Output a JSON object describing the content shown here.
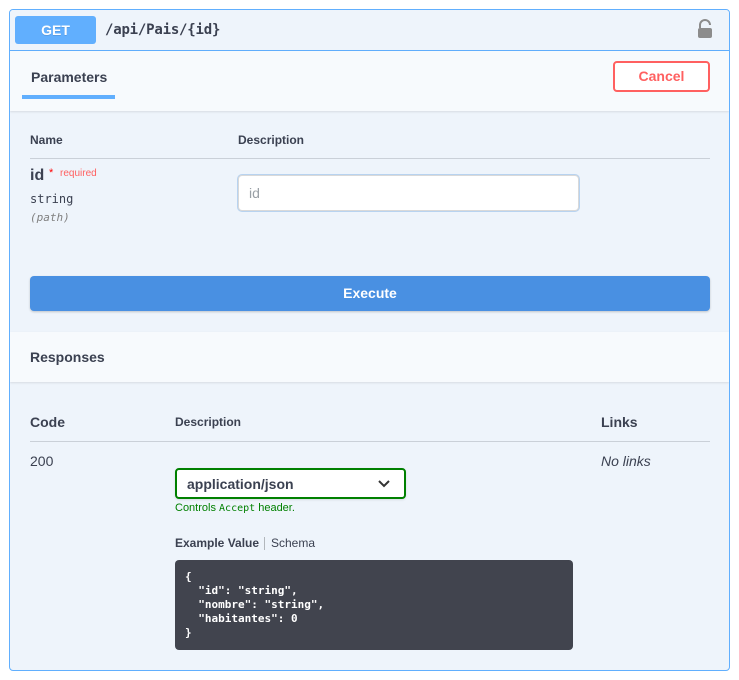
{
  "operation": {
    "method": "GET",
    "path": "/api/Pais/{id}",
    "lock_icon": "unlock-icon"
  },
  "parameters": {
    "tab_label": "Parameters",
    "cancel_label": "Cancel",
    "col_name": "Name",
    "col_description": "Description",
    "items": [
      {
        "name": "id",
        "required_star": "*",
        "required_label": "required",
        "type": "string",
        "in": "(path)",
        "placeholder": "id",
        "value": ""
      }
    ],
    "execute_label": "Execute"
  },
  "responses": {
    "title": "Responses",
    "col_code": "Code",
    "col_description": "Description",
    "col_links": "Links",
    "rows": [
      {
        "code": "200",
        "links": "No links",
        "media_type": "application/json",
        "controls_prefix": "Controls ",
        "controls_header": "Accept",
        "controls_suffix": " header.",
        "tab_example": "Example Value",
        "tab_schema": "Schema",
        "example": "{\n  \"id\": \"string\",\n  \"nombre\": \"string\",\n  \"habitantes\": 0\n}"
      }
    ]
  },
  "colors": {
    "get_accent": "#61affe",
    "cancel": "#ff6060",
    "execute": "#4990e2",
    "media_select_border": "#008000",
    "code_bg": "#41444e"
  }
}
